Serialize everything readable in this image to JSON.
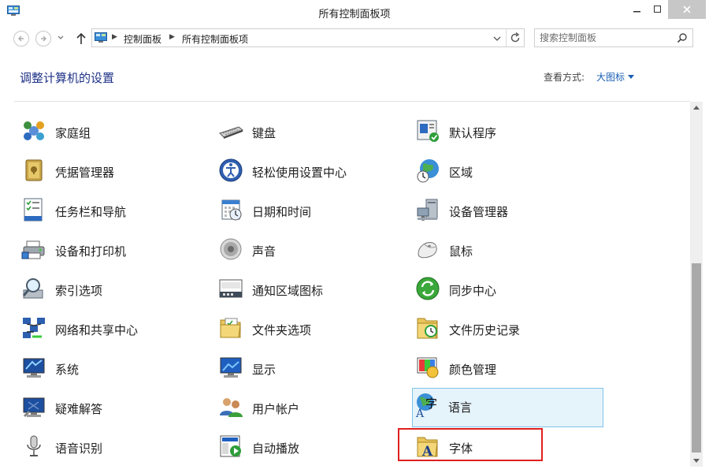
{
  "window": {
    "title": "所有控制面板项"
  },
  "address": {
    "crumbs": [
      "控制面板",
      "所有控制面板项"
    ]
  },
  "search": {
    "placeholder": "搜索控制面板"
  },
  "header": {
    "title": "调整计算机的设置",
    "view_label": "查看方式:",
    "view_value": "大图标"
  },
  "items": [
    {
      "label": "家庭组",
      "icon": "homegroup-icon"
    },
    {
      "label": "键盘",
      "icon": "keyboard-icon"
    },
    {
      "label": "默认程序",
      "icon": "default-programs-icon"
    },
    {
      "label": "凭据管理器",
      "icon": "credential-manager-icon"
    },
    {
      "label": "轻松使用设置中心",
      "icon": "ease-of-access-icon"
    },
    {
      "label": "区域",
      "icon": "region-icon"
    },
    {
      "label": "任务栏和导航",
      "icon": "taskbar-icon"
    },
    {
      "label": "日期和时间",
      "icon": "date-time-icon"
    },
    {
      "label": "设备管理器",
      "icon": "device-manager-icon"
    },
    {
      "label": "设备和打印机",
      "icon": "devices-printers-icon"
    },
    {
      "label": "声音",
      "icon": "sound-icon"
    },
    {
      "label": "鼠标",
      "icon": "mouse-icon"
    },
    {
      "label": "索引选项",
      "icon": "indexing-icon"
    },
    {
      "label": "通知区域图标",
      "icon": "notification-area-icon"
    },
    {
      "label": "同步中心",
      "icon": "sync-center-icon"
    },
    {
      "label": "网络和共享中心",
      "icon": "network-icon"
    },
    {
      "label": "文件夹选项",
      "icon": "folder-options-icon"
    },
    {
      "label": "文件历史记录",
      "icon": "file-history-icon"
    },
    {
      "label": "系统",
      "icon": "system-icon"
    },
    {
      "label": "显示",
      "icon": "display-icon"
    },
    {
      "label": "颜色管理",
      "icon": "color-management-icon"
    },
    {
      "label": "疑难解答",
      "icon": "troubleshooting-icon"
    },
    {
      "label": "用户帐户",
      "icon": "user-accounts-icon"
    },
    {
      "label": "语言",
      "icon": "language-icon"
    },
    {
      "label": "语音识别",
      "icon": "speech-recognition-icon"
    },
    {
      "label": "自动播放",
      "icon": "autoplay-icon"
    },
    {
      "label": "字体",
      "icon": "fonts-icon"
    }
  ],
  "selected_item": "语言",
  "highlighted_item": "字体",
  "colors": {
    "selection_bg": "#e5f3fb",
    "selection_border": "#7fc4e8",
    "highlight_box": "#e02020",
    "link": "#1a5fb4"
  }
}
